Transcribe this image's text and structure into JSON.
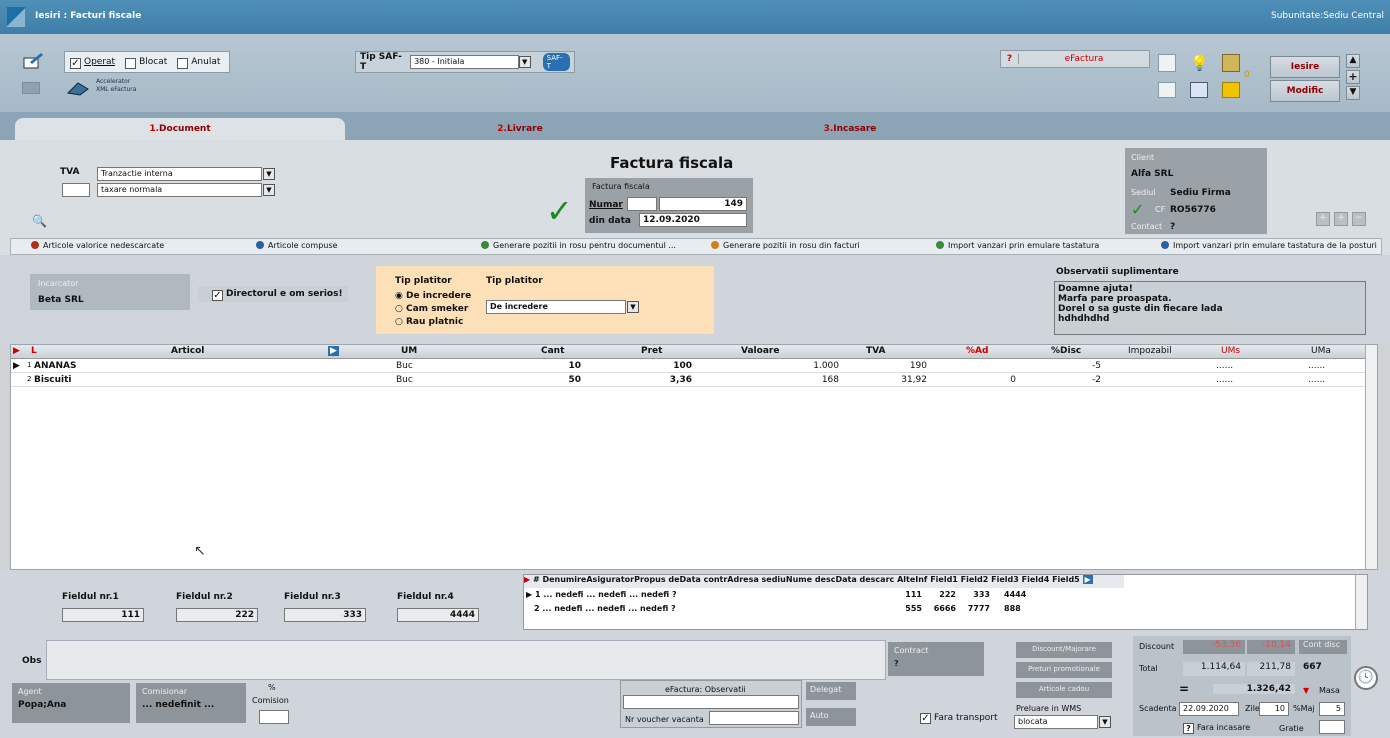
{
  "window": {
    "title": "Iesiri : Facturi fiscale",
    "subunit": "Subunitate:Sediu Central"
  },
  "toolbar": {
    "operat": "Operat",
    "blocat": "Blocat",
    "anulat": "Anulat",
    "accelerator_line1": "Accelerator",
    "accelerator_line2": "XML eFactura",
    "saft_label": "Tip SAF-T",
    "saft_value": "380 - Initiala",
    "saft_badge": "SAF-T",
    "efactura_q": "?",
    "efactura": "eFactura",
    "iesire": "Iesire",
    "modific": "Modific",
    "counter": "0"
  },
  "tabs": [
    {
      "num": "1.",
      "label": "Document"
    },
    {
      "num": "2.",
      "label": "Livrare"
    },
    {
      "num": "3.",
      "label": "Incasare"
    }
  ],
  "document": {
    "tva_label": "TVA",
    "tva_value": "Tranzactie interna",
    "pct_label": "%",
    "taxare_value": "taxare normala",
    "heading": "Factura fiscala",
    "doc_type": "Factura fiscala",
    "numar_label": "Numar",
    "numar_value": "149",
    "din_data_label": "din data",
    "din_data_value": "12.09.2020",
    "client_label": "Client",
    "client_value": "Alfa SRL",
    "sediul_label": "Sediul",
    "sediul_value": "Sediu Firma",
    "cf_label": "CF",
    "cf_value": "RO56776",
    "contact_label": "Contact",
    "contact_value": "?"
  },
  "actions": [
    "Articole valorice nedescarcate",
    "Articole compuse",
    "Generare pozitii in rosu pentru documentul ...",
    "Generare pozitii in rosu din facturi",
    "Import vanzari prin emulare tastatura",
    "Import vanzari prin emulare tastatura de la posturi"
  ],
  "middle": {
    "incarcator_label": "Incarcator",
    "incarcator_value": "Beta SRL",
    "director_label": "Directorul e om serios!",
    "tip_platitor_label": "Tip platitor",
    "radio": [
      "De incredere",
      "Cam smeker",
      "Rau platnic"
    ],
    "tip_platitor2_label": "Tip platitor",
    "tip_platitor2_value": "De incredere",
    "obs_label": "Observatii suplimentare",
    "obs_lines": [
      "Doamne ajuta!",
      "Marfa pare proaspata.",
      "Dorel o sa guste din fiecare lada",
      "hdhdhdhd"
    ]
  },
  "grid": {
    "first_col": "L",
    "columns": [
      "Articol",
      "UM",
      "Cant",
      "Pret",
      "Valoare",
      "TVA",
      "%Ad",
      "%Disc",
      "Impozabil",
      "UMs",
      "UMa"
    ],
    "rows": [
      {
        "nr": "1",
        "articol": "ANANAS",
        "um": "Buc",
        "cant": "10",
        "pret": "100",
        "valoare": "1.000",
        "tva": "190",
        "ad": "",
        "disc": "-5",
        "umsa": "......",
        "umab": "......"
      },
      {
        "nr": "2",
        "articol": "Biscuiti",
        "um": "Buc",
        "cant": "50",
        "pret": "3,36",
        "valoare": "168",
        "tva": "31,92",
        "ad": "0",
        "disc": "-2",
        "umsa": "......",
        "umab": "......"
      }
    ]
  },
  "bottom": {
    "fields": [
      {
        "label": "Fieldul nr.1",
        "value": "111"
      },
      {
        "label": "Fieldul nr.2",
        "value": "222"
      },
      {
        "label": "Fieldul nr.3",
        "value": "333"
      },
      {
        "label": "Fieldul nr.4",
        "value": "4444"
      }
    ],
    "subgrid_cols": [
      "#",
      "Denumire",
      "Asigurator",
      "Propus de",
      "Data contr",
      "Adresa sediu",
      "Nume desc",
      "Data descarc",
      "AlteInf",
      "Field1",
      "Field2",
      "Field3",
      "Field4",
      "Field5"
    ],
    "subgrid_rows": [
      {
        "nr": "1",
        "txt": "... nedefi ... nedefi ... nedefi ?",
        "f1": "111",
        "f2": "222",
        "f3": "333",
        "f4": "4444"
      },
      {
        "nr": "2",
        "txt": "... nedefi ... nedefi ... nedefi ?",
        "f1": "555",
        "f2": "6666",
        "f3": "7777",
        "f4": "888"
      }
    ],
    "obs_label": "Obs",
    "contract_label": "Contract",
    "contract_value": "?",
    "agent_label": "Agent",
    "agent_value": "Popa;Ana",
    "comisionar_label": "Comisionar",
    "comisionar_value": "... nedefinit ...",
    "comision_pct": "%",
    "comision_label": "Comision",
    "efactura_obs": "eFactura: Observatii",
    "nr_voucher": "Nr voucher vacanta",
    "delegat": "Delegat",
    "auto": "Auto",
    "fara_transport": "Fara transport",
    "discount_majorare": "Discount/Majorare",
    "preturi_promo": "Preturi promotionale",
    "articole_cadou": "Articole cadou",
    "preluare_wms": "Preluare in WMS",
    "wms_value": "blocata",
    "discount_label": "Discount",
    "discount_v1": "-53,36",
    "discount_v2": "-10,14",
    "cont_disc_label": "Cont disc",
    "cont_disc_value": "667",
    "total_label": "Total",
    "total_v1": "1.114,64",
    "total_v2": "211,78",
    "grand_eq": "=",
    "grand_total": "1.326,42",
    "masa": "Masa",
    "scadenta_label": "Scadenta",
    "scadenta_value": "22.09.2020",
    "zile_label": "Zile",
    "zile_value": "10",
    "maj_label": "%Maj",
    "maj_value": "5",
    "fara_incasare": "Fara incasare",
    "gratie": "Gratie"
  }
}
